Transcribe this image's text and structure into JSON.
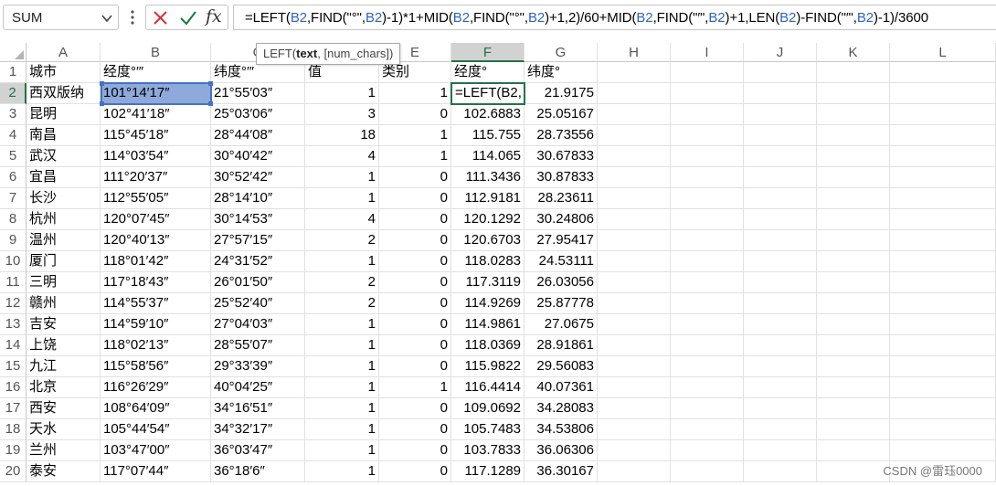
{
  "formula_bar": {
    "name_box": "SUM",
    "fx_label": "fx",
    "formula_parts": [
      {
        "t": "=LEFT(",
        "c": 0
      },
      {
        "t": "B2",
        "c": 1
      },
      {
        "t": ",FIND(\"°\",",
        "c": 0
      },
      {
        "t": "B2",
        "c": 1
      },
      {
        "t": ")-1)*1+MID(",
        "c": 0
      },
      {
        "t": "B2",
        "c": 1
      },
      {
        "t": ",FIND(\"°\",",
        "c": 0
      },
      {
        "t": "B2",
        "c": 1
      },
      {
        "t": ")+1,2)/60+MID(",
        "c": 0
      },
      {
        "t": "B2",
        "c": 1
      },
      {
        "t": ",FIND(\"′\",",
        "c": 0
      },
      {
        "t": "B2",
        "c": 1
      },
      {
        "t": ")+1,LEN(",
        "c": 0
      },
      {
        "t": "B2",
        "c": 1
      },
      {
        "t": ")-FIND(\"′\",",
        "c": 0
      },
      {
        "t": "B2",
        "c": 1
      },
      {
        "t": ")-1)/3600",
        "c": 0
      }
    ],
    "tooltip_func": "LEFT(",
    "tooltip_arg1": "text",
    "tooltip_rest": ", [num_chars])"
  },
  "columns": [
    "A",
    "B",
    "C",
    "D",
    "E",
    "F",
    "G",
    "H",
    "I",
    "J",
    "K",
    "L"
  ],
  "active_column": "F",
  "active_row": 2,
  "headers": [
    "城市",
    "经度°′″",
    "纬度°′″",
    "值",
    "类别",
    "经度°",
    "纬度°"
  ],
  "edit_text": "=LEFT(B2,",
  "rows": [
    {
      "n": "1"
    },
    {
      "n": "2",
      "a": "西双版纳",
      "b": "101°14′17″",
      "c": "21°55′03″",
      "d": "1",
      "e": "1",
      "f": "",
      "g": "21.9175"
    },
    {
      "n": "3",
      "a": "昆明",
      "b": "102°41′18″",
      "c": "25°03′06″",
      "d": "3",
      "e": "0",
      "f": "102.6883",
      "g": "25.05167"
    },
    {
      "n": "4",
      "a": "南昌",
      "b": "115°45′18″",
      "c": "28°44′08″",
      "d": "18",
      "e": "1",
      "f": "115.755",
      "g": "28.73556"
    },
    {
      "n": "5",
      "a": "武汉",
      "b": "114°03′54″",
      "c": "30°40′42″",
      "d": "4",
      "e": "1",
      "f": "114.065",
      "g": "30.67833"
    },
    {
      "n": "6",
      "a": "宜昌",
      "b": "111°20′37″",
      "c": "30°52′42″",
      "d": "1",
      "e": "0",
      "f": "111.3436",
      "g": "30.87833"
    },
    {
      "n": "7",
      "a": "长沙",
      "b": "112°55′05″",
      "c": "28°14′10″",
      "d": "1",
      "e": "0",
      "f": "112.9181",
      "g": "28.23611"
    },
    {
      "n": "8",
      "a": "杭州",
      "b": "120°07′45″",
      "c": "30°14′53″",
      "d": "4",
      "e": "0",
      "f": "120.1292",
      "g": "30.24806"
    },
    {
      "n": "9",
      "a": "温州",
      "b": "120°40′13″",
      "c": "27°57′15″",
      "d": "2",
      "e": "0",
      "f": "120.6703",
      "g": "27.95417"
    },
    {
      "n": "10",
      "a": "厦门",
      "b": "118°01′42″",
      "c": "24°31′52″",
      "d": "1",
      "e": "0",
      "f": "118.0283",
      "g": "24.53111"
    },
    {
      "n": "11",
      "a": "三明",
      "b": "117°18′43″",
      "c": "26°01′50″",
      "d": "2",
      "e": "0",
      "f": "117.3119",
      "g": "26.03056"
    },
    {
      "n": "12",
      "a": "赣州",
      "b": "114°55′37″",
      "c": "25°52′40″",
      "d": "2",
      "e": "0",
      "f": "114.9269",
      "g": "25.87778"
    },
    {
      "n": "13",
      "a": "吉安",
      "b": "114°59′10″",
      "c": "27°04′03″",
      "d": "1",
      "e": "0",
      "f": "114.9861",
      "g": "27.0675"
    },
    {
      "n": "14",
      "a": "上饶",
      "b": "118°02′13″",
      "c": "28°55′07″",
      "d": "1",
      "e": "0",
      "f": "118.0369",
      "g": "28.91861"
    },
    {
      "n": "15",
      "a": "九江",
      "b": "115°58′56″",
      "c": "29°33′39″",
      "d": "1",
      "e": "0",
      "f": "115.9822",
      "g": "29.56083"
    },
    {
      "n": "16",
      "a": "北京",
      "b": "116°26′29″",
      "c": "40°04′25″",
      "d": "1",
      "e": "1",
      "f": "116.4414",
      "g": "40.07361"
    },
    {
      "n": "17",
      "a": "西安",
      "b": "108°64′09″",
      "c": "34°16′51″",
      "d": "1",
      "e": "0",
      "f": "109.0692",
      "g": "34.28083"
    },
    {
      "n": "18",
      "a": "天水",
      "b": "105°44′54″",
      "c": "34°32′17″",
      "d": "1",
      "e": "0",
      "f": "105.7483",
      "g": "34.53806"
    },
    {
      "n": "19",
      "a": "兰州",
      "b": "103°47′00″",
      "c": "36°03′47″",
      "d": "1",
      "e": "0",
      "f": "103.7833",
      "g": "36.06306"
    },
    {
      "n": "20",
      "a": "泰安",
      "b": "117°07′44″",
      "c": "36°18′6″",
      "d": "1",
      "e": "0",
      "f": "117.1289",
      "g": "36.30167"
    }
  ],
  "watermark": "CSDN @雷珏0000",
  "colors": {
    "accent": "#217346",
    "selection": "#8eaadb",
    "ref_blue": "#4472c4",
    "cancel": "#d13438",
    "enter": "#107c41"
  },
  "icons": {
    "cancel": "x-icon",
    "enter": "check-icon",
    "name_box_dropdown": "chevron-down-icon"
  }
}
